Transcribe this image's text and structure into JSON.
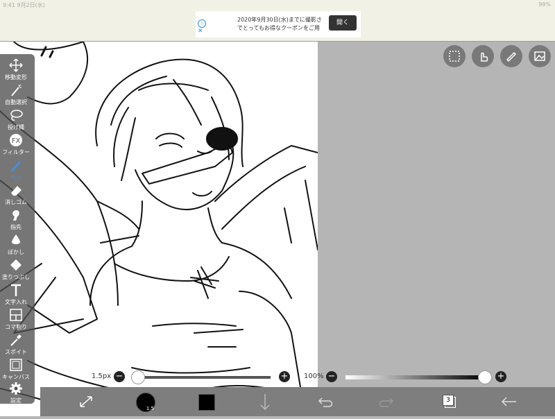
{
  "status_bar": {
    "left_text": "9:41  9月2日(水)",
    "right_text": "99%"
  },
  "ad": {
    "text_line1": "2020年9月30日(水)までに撮影さ",
    "text_line2": "でとってもお得なクーポンをご用",
    "button_label": "開く",
    "info_icon": "info-icon",
    "close_icon": "close-icon"
  },
  "toolbar": {
    "items": [
      {
        "label": "移動変形",
        "icon": "move-icon"
      },
      {
        "label": "自動選択",
        "icon": "magic-wand-icon"
      },
      {
        "label": "投げ縄",
        "icon": "lasso-icon"
      },
      {
        "label": "フィルター",
        "icon": "fx-icon"
      },
      {
        "label": "ペン",
        "icon": "pen-icon",
        "active": true
      },
      {
        "label": "消しゴム",
        "icon": "eraser-icon"
      },
      {
        "label": "指先",
        "icon": "finger-icon"
      },
      {
        "label": "ぼかし",
        "icon": "blur-drop-icon"
      },
      {
        "label": "塗りつぶし",
        "icon": "fill-bucket-icon"
      },
      {
        "label": "文字入れ",
        "icon": "text-icon"
      },
      {
        "label": "コマ割り",
        "icon": "panel-icon"
      },
      {
        "label": "スポイト",
        "icon": "eyedropper-icon"
      },
      {
        "label": "キャンバス",
        "icon": "canvas-icon"
      },
      {
        "label": "設定",
        "icon": "gear-icon"
      }
    ]
  },
  "top_right_icons": [
    "selection-icon",
    "hand-touch-icon",
    "ruler-icon",
    "image-import-icon"
  ],
  "brush_size": {
    "value": "1.5px",
    "level": 0.02
  },
  "opacity": {
    "value": "100%",
    "level": 1.0
  },
  "bottom_bar": {
    "transform_icon": "transform-icon",
    "brush_size_badge": "1.5",
    "color": "#000000",
    "layer_count": "3",
    "icons": [
      "download-icon",
      "undo-icon",
      "redo-icon",
      "layers-icon",
      "back-arrow-icon"
    ]
  },
  "colors": {
    "accent": "#4a8de0",
    "toolbar_bg": "#505050",
    "bottom_bar": "#7e7e7e"
  }
}
